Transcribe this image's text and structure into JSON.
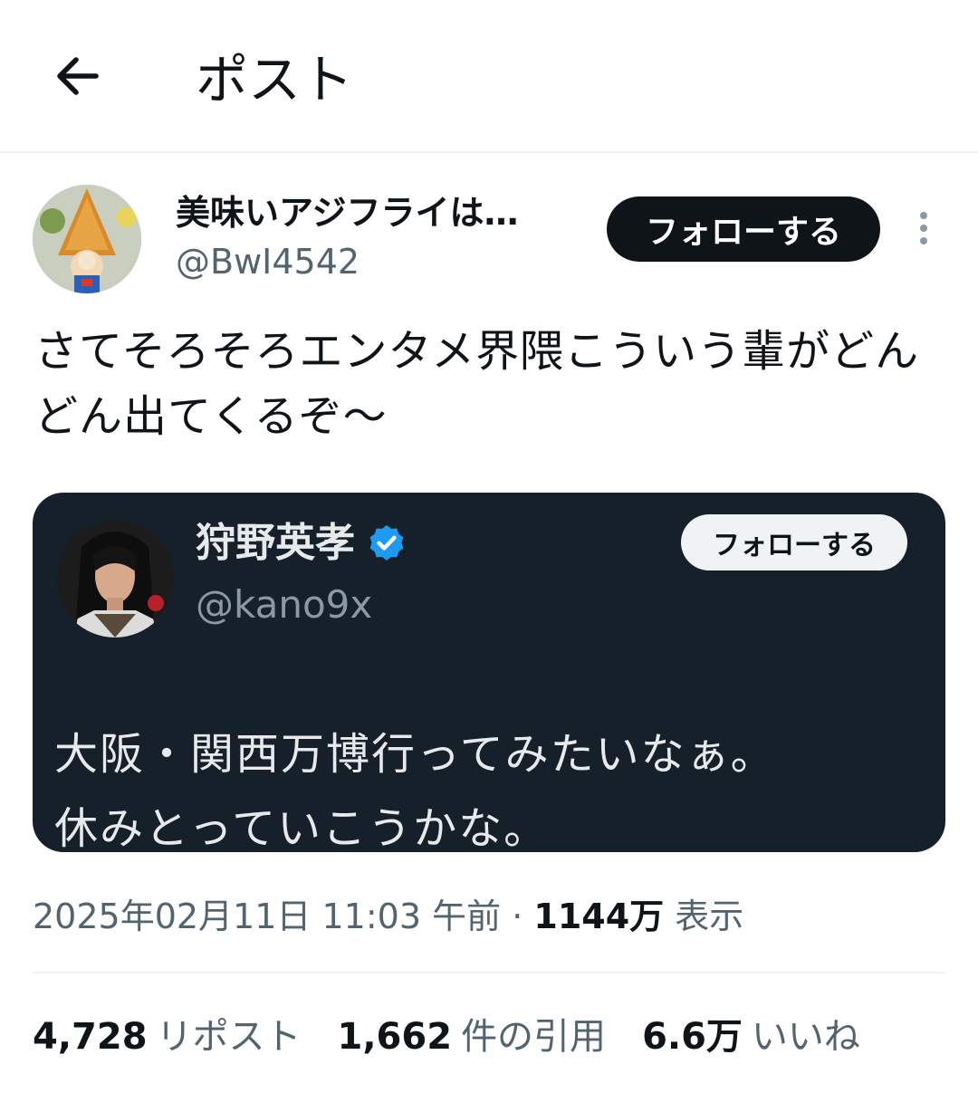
{
  "header": {
    "title": "ポスト",
    "back_icon": "arrow-left-icon"
  },
  "post": {
    "author_name": "美味いアジフライは…",
    "author_handle": "@BwI4542",
    "follow_label": "フォローする",
    "more_icon": "more-vertical-icon",
    "text": "さてそろそろエンタメ界隈こういう輩がどんどん出てくるぞ〜"
  },
  "quoted": {
    "name": "狩野英孝",
    "verified_icon": "verified-badge-icon",
    "handle": "@kano9x",
    "follow_label": "フォローする",
    "text_line1": "大阪・関西万博行ってみたいなぁ。",
    "text_line2": "休みとっていこうかな。"
  },
  "meta": {
    "datetime": "2025年02月11日 11:03 午前",
    "separator": "·",
    "views_count": "1144万",
    "views_label": "表示"
  },
  "stats": [
    {
      "count": "4,728",
      "label": "リポスト"
    },
    {
      "count": "1,662",
      "label": "件の引用"
    },
    {
      "count": "6.6万",
      "label": "いいね"
    }
  ],
  "colors": {
    "accent_verified": "#1d9bf0",
    "quote_bg": "#15202b",
    "text_primary": "#0f1419",
    "text_secondary": "#536471"
  }
}
